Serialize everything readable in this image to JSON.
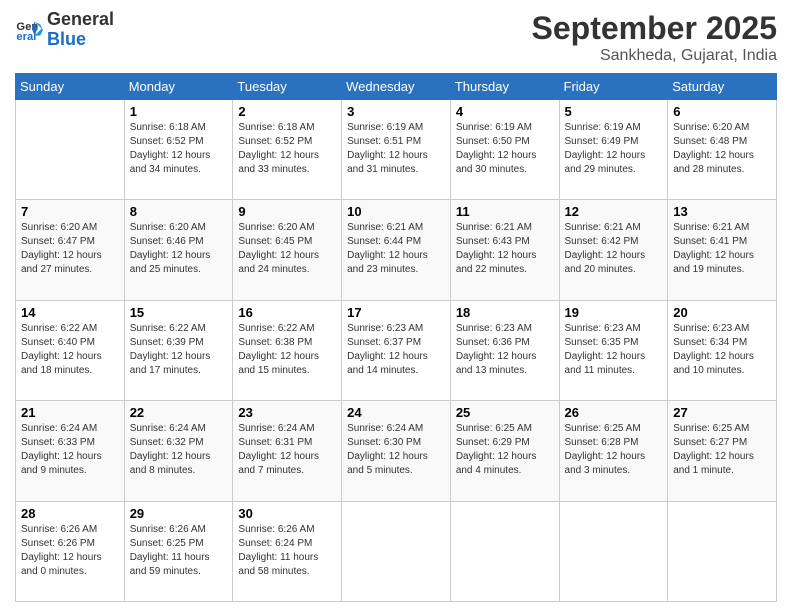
{
  "logo": {
    "line1": "General",
    "line2": "Blue"
  },
  "title": "September 2025",
  "subtitle": "Sankheda, Gujarat, India",
  "days_of_week": [
    "Sunday",
    "Monday",
    "Tuesday",
    "Wednesday",
    "Thursday",
    "Friday",
    "Saturday"
  ],
  "weeks": [
    [
      {
        "date": "",
        "info": ""
      },
      {
        "date": "1",
        "info": "Sunrise: 6:18 AM\nSunset: 6:52 PM\nDaylight: 12 hours\nand 34 minutes."
      },
      {
        "date": "2",
        "info": "Sunrise: 6:18 AM\nSunset: 6:52 PM\nDaylight: 12 hours\nand 33 minutes."
      },
      {
        "date": "3",
        "info": "Sunrise: 6:19 AM\nSunset: 6:51 PM\nDaylight: 12 hours\nand 31 minutes."
      },
      {
        "date": "4",
        "info": "Sunrise: 6:19 AM\nSunset: 6:50 PM\nDaylight: 12 hours\nand 30 minutes."
      },
      {
        "date": "5",
        "info": "Sunrise: 6:19 AM\nSunset: 6:49 PM\nDaylight: 12 hours\nand 29 minutes."
      },
      {
        "date": "6",
        "info": "Sunrise: 6:20 AM\nSunset: 6:48 PM\nDaylight: 12 hours\nand 28 minutes."
      }
    ],
    [
      {
        "date": "7",
        "info": "Sunrise: 6:20 AM\nSunset: 6:47 PM\nDaylight: 12 hours\nand 27 minutes."
      },
      {
        "date": "8",
        "info": "Sunrise: 6:20 AM\nSunset: 6:46 PM\nDaylight: 12 hours\nand 25 minutes."
      },
      {
        "date": "9",
        "info": "Sunrise: 6:20 AM\nSunset: 6:45 PM\nDaylight: 12 hours\nand 24 minutes."
      },
      {
        "date": "10",
        "info": "Sunrise: 6:21 AM\nSunset: 6:44 PM\nDaylight: 12 hours\nand 23 minutes."
      },
      {
        "date": "11",
        "info": "Sunrise: 6:21 AM\nSunset: 6:43 PM\nDaylight: 12 hours\nand 22 minutes."
      },
      {
        "date": "12",
        "info": "Sunrise: 6:21 AM\nSunset: 6:42 PM\nDaylight: 12 hours\nand 20 minutes."
      },
      {
        "date": "13",
        "info": "Sunrise: 6:21 AM\nSunset: 6:41 PM\nDaylight: 12 hours\nand 19 minutes."
      }
    ],
    [
      {
        "date": "14",
        "info": "Sunrise: 6:22 AM\nSunset: 6:40 PM\nDaylight: 12 hours\nand 18 minutes."
      },
      {
        "date": "15",
        "info": "Sunrise: 6:22 AM\nSunset: 6:39 PM\nDaylight: 12 hours\nand 17 minutes."
      },
      {
        "date": "16",
        "info": "Sunrise: 6:22 AM\nSunset: 6:38 PM\nDaylight: 12 hours\nand 15 minutes."
      },
      {
        "date": "17",
        "info": "Sunrise: 6:23 AM\nSunset: 6:37 PM\nDaylight: 12 hours\nand 14 minutes."
      },
      {
        "date": "18",
        "info": "Sunrise: 6:23 AM\nSunset: 6:36 PM\nDaylight: 12 hours\nand 13 minutes."
      },
      {
        "date": "19",
        "info": "Sunrise: 6:23 AM\nSunset: 6:35 PM\nDaylight: 12 hours\nand 11 minutes."
      },
      {
        "date": "20",
        "info": "Sunrise: 6:23 AM\nSunset: 6:34 PM\nDaylight: 12 hours\nand 10 minutes."
      }
    ],
    [
      {
        "date": "21",
        "info": "Sunrise: 6:24 AM\nSunset: 6:33 PM\nDaylight: 12 hours\nand 9 minutes."
      },
      {
        "date": "22",
        "info": "Sunrise: 6:24 AM\nSunset: 6:32 PM\nDaylight: 12 hours\nand 8 minutes."
      },
      {
        "date": "23",
        "info": "Sunrise: 6:24 AM\nSunset: 6:31 PM\nDaylight: 12 hours\nand 7 minutes."
      },
      {
        "date": "24",
        "info": "Sunrise: 6:24 AM\nSunset: 6:30 PM\nDaylight: 12 hours\nand 5 minutes."
      },
      {
        "date": "25",
        "info": "Sunrise: 6:25 AM\nSunset: 6:29 PM\nDaylight: 12 hours\nand 4 minutes."
      },
      {
        "date": "26",
        "info": "Sunrise: 6:25 AM\nSunset: 6:28 PM\nDaylight: 12 hours\nand 3 minutes."
      },
      {
        "date": "27",
        "info": "Sunrise: 6:25 AM\nSunset: 6:27 PM\nDaylight: 12 hours\nand 1 minute."
      }
    ],
    [
      {
        "date": "28",
        "info": "Sunrise: 6:26 AM\nSunset: 6:26 PM\nDaylight: 12 hours\nand 0 minutes."
      },
      {
        "date": "29",
        "info": "Sunrise: 6:26 AM\nSunset: 6:25 PM\nDaylight: 11 hours\nand 59 minutes."
      },
      {
        "date": "30",
        "info": "Sunrise: 6:26 AM\nSunset: 6:24 PM\nDaylight: 11 hours\nand 58 minutes."
      },
      {
        "date": "",
        "info": ""
      },
      {
        "date": "",
        "info": ""
      },
      {
        "date": "",
        "info": ""
      },
      {
        "date": "",
        "info": ""
      }
    ]
  ]
}
